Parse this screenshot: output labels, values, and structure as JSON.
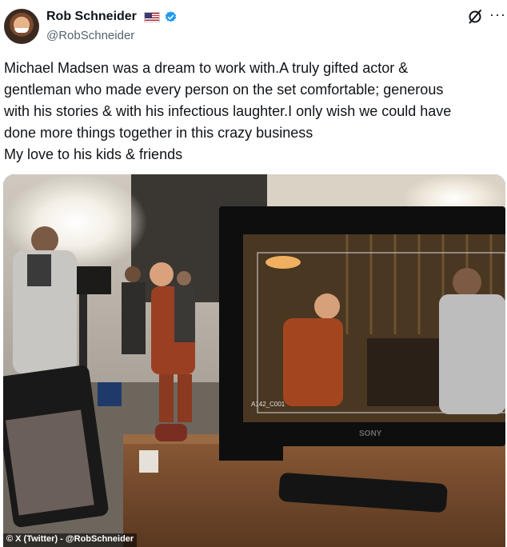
{
  "author": {
    "name": "Rob Schneider",
    "handle": "@RobSchneider",
    "flag_icon": "us-flag-icon",
    "verified_icon": "verified-badge-icon"
  },
  "actions": {
    "grok_icon": "grok-icon",
    "more_icon": "more-icon",
    "more_label": "···"
  },
  "post": {
    "lines": [
      "Michael Madsen was a dream to work with.A truly gifted actor &",
      "gentleman who made every person on the set comfortable; generous",
      "with his stories & with his infectious laughter.I only wish we could have",
      "done more things together in this crazy business",
      "My love to his kids & friends"
    ]
  },
  "media": {
    "monitor_brand": "SONY",
    "monitor_clip_label": "A142_C001",
    "credit": "© X (Twitter) - @RobSchneider"
  },
  "colors": {
    "verified": "#1d9bf0",
    "text": "#0f1419",
    "secondary": "#536471"
  }
}
